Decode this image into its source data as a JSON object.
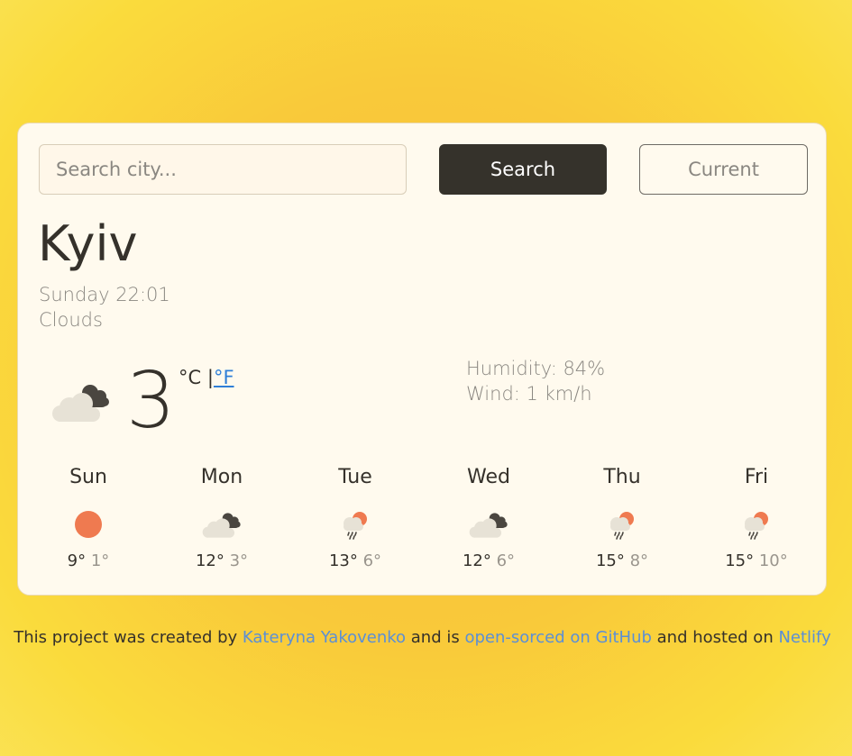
{
  "search": {
    "placeholder": "Search city...",
    "value": ""
  },
  "buttons": {
    "search_label": "Search",
    "current_label": "Current"
  },
  "current": {
    "city": "Kyiv",
    "datetime": "Sunday 22:01",
    "description": "Clouds",
    "temperature": "3",
    "icon": "broken-clouds-icon",
    "unit_celsius": "°C",
    "unit_separator": "|",
    "unit_fahrenheit": "°F",
    "humidity": "Humidity: 84%",
    "wind": "Wind: 1 km/h"
  },
  "forecast": [
    {
      "day": "Sun",
      "icon": "sun-icon",
      "max": "9°",
      "min": "1°"
    },
    {
      "day": "Mon",
      "icon": "broken-clouds-icon",
      "max": "12°",
      "min": "3°"
    },
    {
      "day": "Tue",
      "icon": "rain-sun-icon",
      "max": "13°",
      "min": "6°"
    },
    {
      "day": "Wed",
      "icon": "broken-clouds-icon",
      "max": "12°",
      "min": "6°"
    },
    {
      "day": "Thu",
      "icon": "rain-sun-icon",
      "max": "15°",
      "min": "8°"
    },
    {
      "day": "Fri",
      "icon": "rain-sun-icon",
      "max": "15°",
      "min": "10°"
    }
  ],
  "footer": {
    "text1": "This project was created by ",
    "author_link": "Kateryna Yakovenko",
    "text2": " and is ",
    "github_link": "open-sorced on GitHub",
    "text3": " and hosted on ",
    "netlify_link": "Netlify"
  },
  "colors": {
    "accent_link": "#2f7fd7",
    "button_dark": "#35322b",
    "sun": "#ef7a50"
  }
}
